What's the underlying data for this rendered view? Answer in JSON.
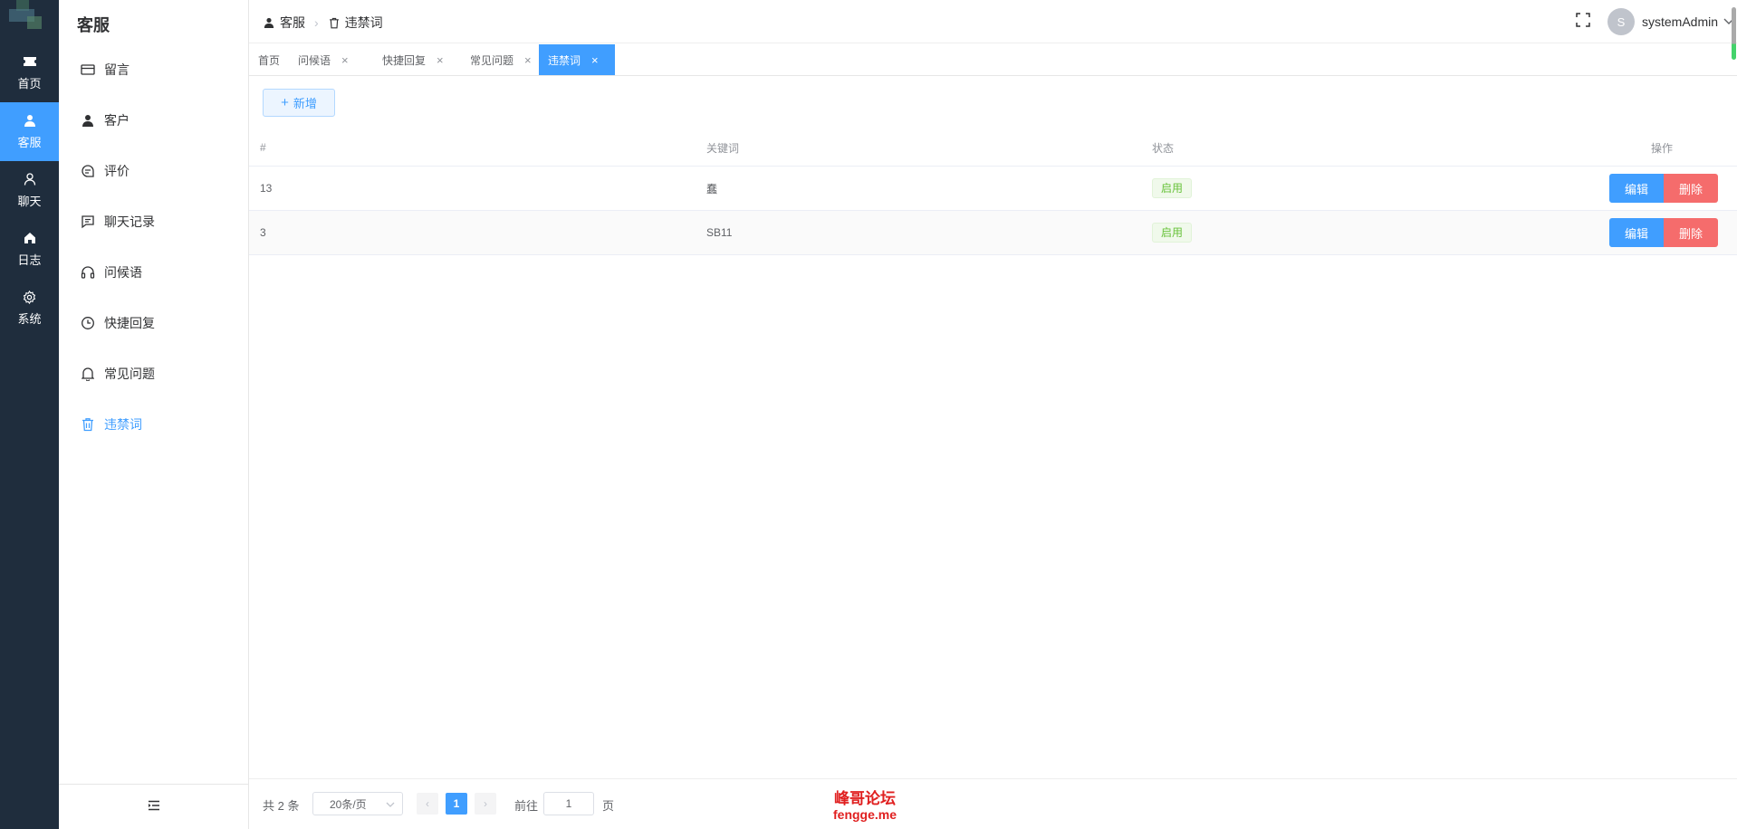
{
  "rail": {
    "items": [
      {
        "label": "首页",
        "icon": "ticket-icon"
      },
      {
        "label": "客服",
        "icon": "user-icon"
      },
      {
        "label": "聊天",
        "icon": "user-outline-icon"
      },
      {
        "label": "日志",
        "icon": "home-icon"
      },
      {
        "label": "系统",
        "icon": "gear-icon"
      }
    ],
    "active_color": "#409eff",
    "bg_color": "#1f2d3d"
  },
  "sidebar": {
    "title": "客服",
    "items": [
      {
        "label": "留言",
        "icon": "card-icon"
      },
      {
        "label": "客户",
        "icon": "user-filled-icon"
      },
      {
        "label": "评价",
        "icon": "chat-round-icon"
      },
      {
        "label": "聊天记录",
        "icon": "chat-square-icon"
      },
      {
        "label": "问候语",
        "icon": "headset-icon"
      },
      {
        "label": "快捷回复",
        "icon": "clock-icon"
      },
      {
        "label": "常见问题",
        "icon": "bell-icon"
      },
      {
        "label": "违禁词",
        "icon": "trash-icon"
      }
    ],
    "active_index": 7
  },
  "breadcrumb": {
    "items": [
      {
        "label": "客服",
        "icon": "user-filled-icon"
      },
      {
        "label": "违禁词",
        "icon": "trash-icon"
      }
    ]
  },
  "header": {
    "avatar_initial": "S",
    "username": "systemAdmin"
  },
  "tabs": [
    {
      "label": "首页",
      "closable": false
    },
    {
      "label": "问候语",
      "closable": true
    },
    {
      "label": "快捷回复",
      "closable": true
    },
    {
      "label": "常见问题",
      "closable": true
    },
    {
      "label": "违禁词",
      "closable": true,
      "active": true
    }
  ],
  "toolbar": {
    "add_label": "新增"
  },
  "table": {
    "columns": [
      "#",
      "关键词",
      "状态",
      "操作"
    ],
    "rows": [
      {
        "id": "13",
        "keyword": "蠢",
        "status": "启用",
        "edit": "编辑",
        "delete": "删除"
      },
      {
        "id": "3",
        "keyword": "SB11",
        "status": "启用",
        "edit": "编辑",
        "delete": "删除"
      }
    ]
  },
  "pagination": {
    "total_text": "共 2 条",
    "page_size": "20条/页",
    "current_page": "1",
    "goto_label": "前往",
    "goto_value": "1",
    "page_unit": "页"
  },
  "watermark": {
    "line1": "峰哥论坛",
    "line2": "fengge.me"
  }
}
